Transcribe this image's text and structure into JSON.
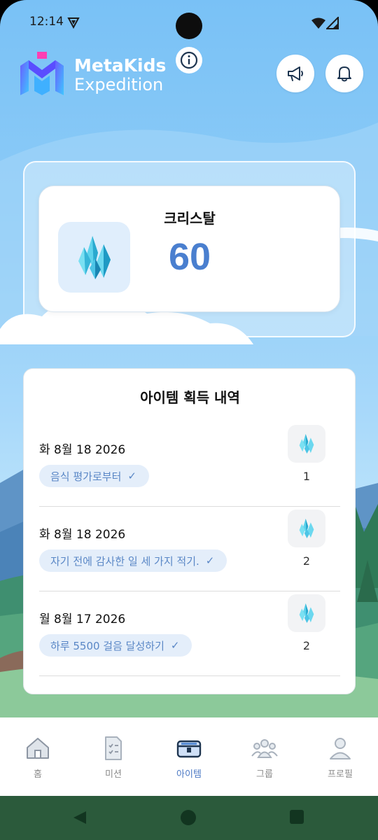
{
  "status_bar": {
    "time": "12:14"
  },
  "header": {
    "brand_line1": "MetaKids",
    "brand_line2": "Expedition",
    "icons": [
      "logo-icon",
      "info-icon",
      "megaphone-icon",
      "bell-icon"
    ]
  },
  "crystal": {
    "title": "크리스탈",
    "count": "60",
    "icon": "crystal-icon"
  },
  "history": {
    "title": "아이템 획득 내역",
    "items": [
      {
        "date": "화 8월 18 2026",
        "source": "음식 평가로부터",
        "check": "✓",
        "count": "1"
      },
      {
        "date": "화 8월 18 2026",
        "source": "자기 전에 감사한 일 세 가지 적기.",
        "check": "✓",
        "count": "2"
      },
      {
        "date": "월 8월 17 2026",
        "source": "하루 5500 걸음 달성하기",
        "check": "✓",
        "count": "2"
      }
    ]
  },
  "bottom_nav": {
    "items": [
      {
        "label": "홈",
        "icon": "home-icon",
        "active": false
      },
      {
        "label": "미션",
        "icon": "mission-checklist-icon",
        "active": false
      },
      {
        "label": "아이템",
        "icon": "item-chest-icon",
        "active": true
      },
      {
        "label": "그룹",
        "icon": "group-icon",
        "active": false
      },
      {
        "label": "프로필",
        "icon": "profile-icon",
        "active": false
      }
    ]
  },
  "colors": {
    "accent": "#4a7fcf",
    "chip_bg": "#e4eefa",
    "chip_text": "#5a87c6",
    "sky": "#8ccbf7",
    "system_nav": "#2b5a3b"
  }
}
